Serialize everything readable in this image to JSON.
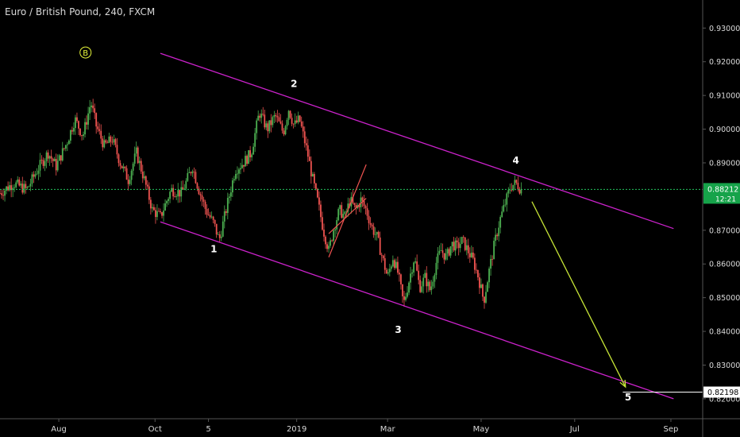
{
  "header": {
    "title": "Euro / British Pound, 240, FXCM"
  },
  "colors": {
    "background": "#000000",
    "candle_up": "#4caf50",
    "candle_down": "#ef5350",
    "channel": "#cc22cc",
    "price_line": "#22c55e",
    "price_tag_bg": "#16a34a",
    "arrow": "#c8e637",
    "wave_marker": "#e6f53a",
    "axis_text": "#d9d9d9",
    "axis_line": "#555555",
    "target_tag_bg": "#ffffff"
  },
  "chart_data": {
    "type": "candlestick",
    "title": "Euro / British Pound, 240, FXCM",
    "symbol": "EURGBP",
    "timeframe": "240",
    "source": "FXCM",
    "x_ticks": [
      "Aug",
      "Oct",
      "5",
      "2019",
      "Mar",
      "May",
      "Jul",
      "Sep"
    ],
    "y_ticks": [
      "0.93000",
      "0.92000",
      "0.91000",
      "0.90000",
      "0.89000",
      "0.87000",
      "0.86000",
      "0.85000",
      "0.84000",
      "0.83000",
      "0.82000"
    ],
    "ylim": [
      0.8188,
      0.9362
    ],
    "current_price": {
      "value": 0.88212,
      "label": "0.88212",
      "countdown": "12:21"
    },
    "target_price": {
      "value": 0.82198,
      "label": "0.82198"
    },
    "price_path": [
      {
        "t": 0,
        "p": 0.881
      },
      {
        "t": 5,
        "p": 0.884
      },
      {
        "t": 10,
        "p": 0.882
      },
      {
        "t": 14,
        "p": 0.888
      },
      {
        "t": 18,
        "p": 0.893
      },
      {
        "t": 21,
        "p": 0.889
      },
      {
        "t": 25,
        "p": 0.896
      },
      {
        "t": 28,
        "p": 0.903
      },
      {
        "t": 31,
        "p": 0.898
      },
      {
        "t": 34,
        "p": 0.908
      },
      {
        "t": 36,
        "p": 0.901
      },
      {
        "t": 39,
        "p": 0.895
      },
      {
        "t": 42,
        "p": 0.897
      },
      {
        "t": 45,
        "p": 0.89
      },
      {
        "t": 48,
        "p": 0.885
      },
      {
        "t": 51,
        "p": 0.893
      },
      {
        "t": 54,
        "p": 0.885
      },
      {
        "t": 57,
        "p": 0.876
      },
      {
        "t": 60,
        "p": 0.874
      },
      {
        "t": 64,
        "p": 0.882
      },
      {
        "t": 68,
        "p": 0.881
      },
      {
        "t": 72,
        "p": 0.889
      },
      {
        "t": 74,
        "p": 0.883
      },
      {
        "t": 77,
        "p": 0.876
      },
      {
        "t": 80,
        "p": 0.872
      },
      {
        "t": 82,
        "p": 0.867
      },
      {
        "t": 84,
        "p": 0.874
      },
      {
        "t": 86,
        "p": 0.881
      },
      {
        "t": 88,
        "p": 0.888
      },
      {
        "t": 91,
        "p": 0.89
      },
      {
        "t": 94,
        "p": 0.893
      },
      {
        "t": 97,
        "p": 0.905
      },
      {
        "t": 100,
        "p": 0.9
      },
      {
        "t": 103,
        "p": 0.904
      },
      {
        "t": 106,
        "p": 0.899
      },
      {
        "t": 108,
        "p": 0.906
      },
      {
        "t": 110,
        "p": 0.901
      },
      {
        "t": 112,
        "p": 0.903
      },
      {
        "t": 115,
        "p": 0.893
      },
      {
        "t": 117,
        "p": 0.885
      },
      {
        "t": 119,
        "p": 0.878
      },
      {
        "t": 121,
        "p": 0.87
      },
      {
        "t": 123,
        "p": 0.864
      },
      {
        "t": 125,
        "p": 0.871
      },
      {
        "t": 127,
        "p": 0.876
      },
      {
        "t": 129,
        "p": 0.874
      },
      {
        "t": 131,
        "p": 0.879
      },
      {
        "t": 133,
        "p": 0.876
      },
      {
        "t": 135,
        "p": 0.879
      },
      {
        "t": 137,
        "p": 0.876
      },
      {
        "t": 139,
        "p": 0.871
      },
      {
        "t": 141,
        "p": 0.868
      },
      {
        "t": 143,
        "p": 0.862
      },
      {
        "t": 145,
        "p": 0.856
      },
      {
        "t": 147,
        "p": 0.862
      },
      {
        "t": 149,
        "p": 0.857
      },
      {
        "t": 151,
        "p": 0.848
      },
      {
        "t": 153,
        "p": 0.855
      },
      {
        "t": 155,
        "p": 0.862
      },
      {
        "t": 157,
        "p": 0.853
      },
      {
        "t": 159,
        "p": 0.856
      },
      {
        "t": 161,
        "p": 0.852
      },
      {
        "t": 163,
        "p": 0.86
      },
      {
        "t": 165,
        "p": 0.864
      },
      {
        "t": 167,
        "p": 0.862
      },
      {
        "t": 169,
        "p": 0.866
      },
      {
        "t": 171,
        "p": 0.865
      },
      {
        "t": 173,
        "p": 0.867
      },
      {
        "t": 175,
        "p": 0.864
      },
      {
        "t": 177,
        "p": 0.861
      },
      {
        "t": 179,
        "p": 0.856
      },
      {
        "t": 181,
        "p": 0.849
      },
      {
        "t": 183,
        "p": 0.858
      },
      {
        "t": 185,
        "p": 0.866
      },
      {
        "t": 187,
        "p": 0.873
      },
      {
        "t": 189,
        "p": 0.878
      },
      {
        "t": 191,
        "p": 0.883
      },
      {
        "t": 193,
        "p": 0.884
      },
      {
        "t": 195,
        "p": 0.882
      }
    ],
    "channel": {
      "upper": [
        {
          "t": 60,
          "p": 0.9225
        },
        {
          "t": 252,
          "p": 0.8705
        }
      ],
      "lower": [
        {
          "t": 60,
          "p": 0.8725
        },
        {
          "t": 252,
          "p": 0.82
        }
      ]
    },
    "red_lines": [
      {
        "from": {
          "t": 123,
          "p": 0.862
        },
        "to": {
          "t": 137,
          "p": 0.8895
        }
      },
      {
        "from": {
          "t": 123,
          "p": 0.869
        },
        "to": {
          "t": 137,
          "p": 0.8795
        }
      }
    ],
    "projection_arrow": {
      "from": {
        "t": 199,
        "p": 0.8785
      },
      "to": {
        "t": 234,
        "p": 0.8235
      }
    },
    "wave_labels": [
      {
        "label": "B",
        "t": 32,
        "p": 0.9218,
        "circled": true
      },
      {
        "label": "1",
        "t": 80,
        "p": 0.8635
      },
      {
        "label": "2",
        "t": 110,
        "p": 0.9125
      },
      {
        "label": "3",
        "t": 149,
        "p": 0.8395
      },
      {
        "label": "4",
        "t": 193,
        "p": 0.8898
      },
      {
        "label": "5",
        "t": 235,
        "p": 0.8195
      }
    ],
    "x_tick_positions": [
      {
        "label": "Aug",
        "t": 22
      },
      {
        "label": "Oct",
        "t": 58
      },
      {
        "label": "5",
        "t": 78
      },
      {
        "label": "2019",
        "t": 111
      },
      {
        "label": "Mar",
        "t": 145
      },
      {
        "label": "May",
        "t": 180
      },
      {
        "label": "Jul",
        "t": 215
      },
      {
        "label": "Sep",
        "t": 251
      }
    ],
    "t_range": [
      0,
      262
    ],
    "grid": false
  }
}
